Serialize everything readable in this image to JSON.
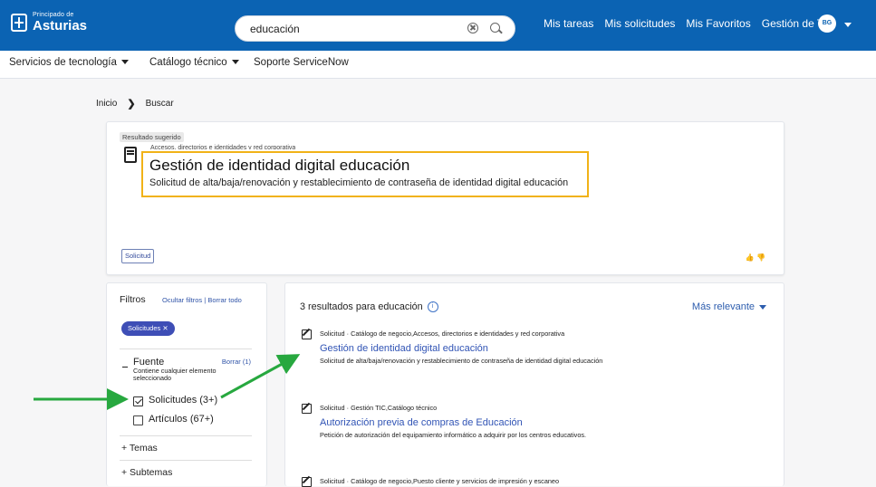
{
  "header": {
    "logo_small": "Principado de",
    "logo_big": "Asturias",
    "search_value": "educación",
    "links": [
      "Mis tareas",
      "Mis solicitudes",
      "Mis Favoritos",
      "Gestión de TI"
    ],
    "avatar": "BG"
  },
  "nav": {
    "items": [
      {
        "label": "Servicios de tecnología"
      },
      {
        "label": "Catálogo técnico"
      },
      {
        "label": "Soporte ServiceNow"
      }
    ]
  },
  "breadcrumb": {
    "home": "Inicio",
    "current": "Buscar"
  },
  "suggested": {
    "badge": "Resultado sugerido",
    "category": "Accesos, directorios e identidades y red corporativa",
    "title": "Gestión de identidad digital educación",
    "description": "Solicitud de alta/baja/renovación y restablecimiento de contraseña de identidad digital educación",
    "tag": "Solicitud"
  },
  "filters": {
    "title": "Filtros",
    "hide": "Ocultar filtros",
    "clear_all": "Borrar todo",
    "chip": "Solicitudes",
    "source_title": "Fuente",
    "source_clear": "Borrar (1)",
    "source_desc": "Contiene cualquier elemento seleccionado",
    "option1": "Solicitudes (3+)",
    "option2": "Artículos (67+)",
    "themes": "+ Temas",
    "subthemes": "+ Subtemas"
  },
  "results": {
    "count": "3 resultados para educación",
    "sort": "Más relevante",
    "items": [
      {
        "meta": "Solicitud · Catálogo de negocio,Accesos, directorios e identidades y red corporativa",
        "title": "Gestión de identidad digital educación",
        "desc": "Solicitud de alta/baja/renovación y restablecimiento de contraseña de identidad digital educación"
      },
      {
        "meta": "Solicitud · Gestión TIC,Catálogo técnico",
        "title": "Autorización previa de compras de Educación",
        "desc": "Petición de autorización del equipamiento informático a adquirir por los centros educativos."
      },
      {
        "meta": "Solicitud · Catálogo de negocio,Puesto cliente y servicios de impresión y escaneo",
        "title": "",
        "desc": ""
      }
    ]
  },
  "colors": {
    "header": "#0b63b3",
    "highlight": "#f1b217",
    "link": "#3154b5",
    "arrow": "#27a83f"
  }
}
